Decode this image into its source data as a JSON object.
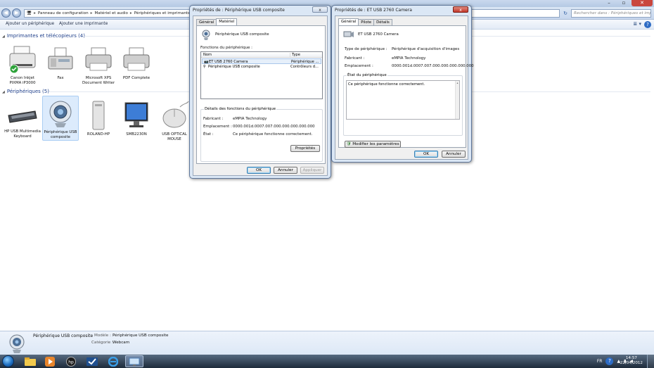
{
  "explorer": {
    "breadcrumb": [
      "Panneau de configuration",
      "Matériel et audio",
      "Périphériques et imprimantes"
    ],
    "search_placeholder": "Rechercher dans : Périphériques et impr...",
    "toolbar": {
      "add_device": "Ajouter un périphérique",
      "add_printer": "Ajouter une imprimante"
    },
    "printers_group": {
      "title": "Imprimantes et télécopieurs (4)",
      "items": [
        {
          "label": "Canon Inkjet PIXMA iP3000"
        },
        {
          "label": "Fax"
        },
        {
          "label": "Microsoft XPS Document Writer"
        },
        {
          "label": "PDF Complete"
        }
      ]
    },
    "devices_group": {
      "title": "Périphériques (5)",
      "items": [
        {
          "label": "HP USB Multimedia Keyboard"
        },
        {
          "label": "Périphérique USB composite"
        },
        {
          "label": "ROLAND-HP"
        },
        {
          "label": "SMB2230N"
        },
        {
          "label": "USB OPTICAL MOUSE"
        }
      ]
    },
    "details": {
      "name": "Périphérique USB composite",
      "model_label": "Modèle :",
      "model_value": "Périphérique USB composite",
      "category_label": "Catégorie :",
      "category_value": "Webcam"
    }
  },
  "dialog1": {
    "title": "Propriétés de : Périphérique USB composite",
    "close": "x",
    "tabs": [
      "Général",
      "Matériel"
    ],
    "active_tab": "Matériel",
    "device_name": "Périphérique USB composite",
    "functions_label": "Fonctions du périphérique :",
    "columns": [
      "Nom",
      "Type"
    ],
    "rows": [
      {
        "name": "ET USB 2760 Camera",
        "type": "Périphérique ..."
      },
      {
        "name": "Périphérique USB composite",
        "type": "Contrôleurs d..."
      }
    ],
    "details_group": "Détails des fonctions du périphérique",
    "manufacturer_label": "Fabricant :",
    "manufacturer_value": "eMPIA Technology",
    "location_label": "Emplacement :",
    "location_value": "0000.001d.0007.007.000.000.000.000.000",
    "status_label": "État :",
    "status_value": "Ce périphérique fonctionne correctement.",
    "properties_btn": "Propriétés",
    "ok": "OK",
    "cancel": "Annuler",
    "apply": "Appliquer"
  },
  "dialog2": {
    "title": "Propriétés de : ET USB 2760 Camera",
    "close": "x",
    "tabs": [
      "Général",
      "Pilote",
      "Détails"
    ],
    "active_tab": "Général",
    "device_name": "ET USB 2760 Camera",
    "type_label": "Type de périphérique :",
    "type_value": "Périphérique d'acquisition d'images",
    "manufacturer_label": "Fabricant :",
    "manufacturer_value": "eMPIA Technology",
    "location_label": "Emplacement :",
    "location_value": "0000.001d.0007.007.000.000.000.000.000",
    "status_group": "État du périphérique",
    "status_text": "Ce périphérique fonctionne correctement.",
    "change_settings": "Modifier les paramètres",
    "ok": "OK",
    "cancel": "Annuler"
  },
  "taskbar": {
    "lang": "FR",
    "time": "14:57",
    "date": "22/04/2012"
  }
}
